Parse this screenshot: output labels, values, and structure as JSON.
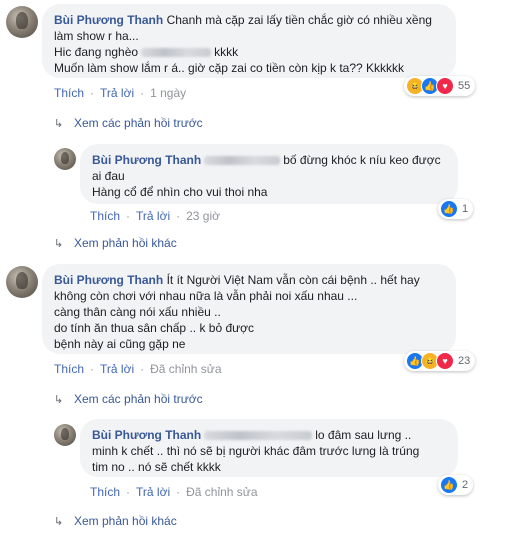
{
  "colors": {
    "name": "#385898",
    "link": "#4267b2",
    "bubble": "#f2f3f5",
    "meta": "#90949c"
  },
  "comments": [
    {
      "author": "Bùi Phương Thanh",
      "lines": [
        "Chanh mà cặp zai lấy tiền chắc giờ có nhiều xềng",
        "làm show r ha...",
        "Hic đang nghèo",
        "kkkk",
        "Muốn làm show lắm r á.. giờ cặp zai co tiền còn kịp k ta?? Kkkkkk"
      ],
      "like": "Thích",
      "reply": "Trả lời",
      "time": "1 ngày",
      "reaction_count": "55"
    },
    {
      "more_replies": "Xem các phản hồi trước"
    },
    {
      "author": "Bùi Phương Thanh",
      "lines": [
        "bố đừng khóc k níu keo được",
        "ai đau",
        "Hàng cổ để nhìn cho vui thoi nha"
      ],
      "like": "Thích",
      "reply": "Trả lời",
      "time": "23 giờ",
      "reaction_count": "1"
    },
    {
      "more_replies": "Xem phản hồi khác"
    },
    {
      "author": "Bùi Phương Thanh",
      "lines": [
        "Ít ít Người Việt Nam vẫn còn cái bệnh .. hết hay",
        "không còn chơi với nhau nữa là vẫn phải noi xấu nhau ...",
        "càng thân càng nói xấu nhiều ..",
        "do tính ăn thua sân chấp .. k bỏ được",
        "bệnh này ai cũng gặp ne"
      ],
      "like": "Thích",
      "reply": "Trả lời",
      "edited": "Đã chỉnh sửa",
      "reaction_count": "23"
    },
    {
      "more_replies": "Xem các phản hồi trước"
    },
    {
      "author": "Bùi Phương Thanh",
      "lines": [
        "lo đâm sau lưng ..",
        "minh k chết .. thì nó sẽ bị người khác đâm trước lưng là trúng",
        "tim no .. nó sẽ chết kkkk"
      ],
      "like": "Thích",
      "reply": "Trả lời",
      "edited": "Đã chỉnh sửa",
      "reaction_count": "2"
    },
    {
      "more_replies": "Xem phản hồi khác"
    }
  ],
  "icons": {
    "reply_arrow": "reply-arrow-icon",
    "like": "like-icon",
    "haha": "haha-icon",
    "love": "love-icon"
  }
}
